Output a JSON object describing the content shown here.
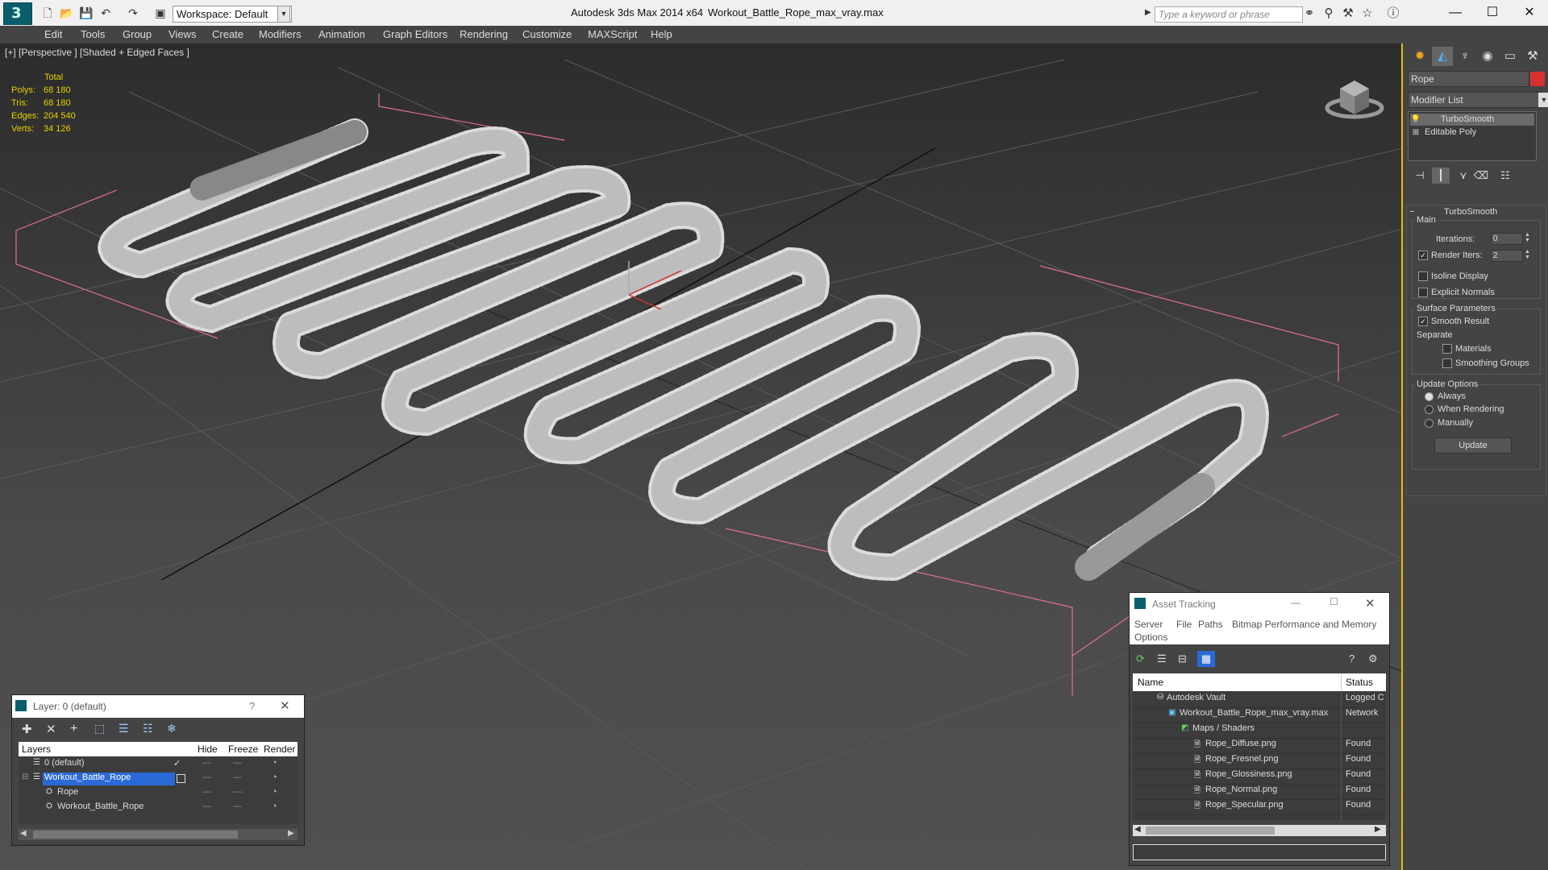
{
  "titlebar": {
    "workspace": "Workspace: Default",
    "app_title": "Autodesk 3ds Max  2014 x64",
    "file_title": "Workout_Battle_Rope_max_vray.max",
    "search_placeholder": "Type a keyword or phrase",
    "minimize": "—",
    "maximize": "☐",
    "close": "✕"
  },
  "menu": [
    "Edit",
    "Tools",
    "Group",
    "Views",
    "Create",
    "Modifiers",
    "Animation",
    "Graph Editors",
    "Rendering",
    "Customize",
    "MAXScript",
    "Help"
  ],
  "viewport": {
    "label": "[+] [Perspective ] [Shaded + Edged Faces ]",
    "stats": {
      "header": "Total",
      "rows": [
        {
          "label": "Polys:",
          "value": "68 180"
        },
        {
          "label": "Tris:",
          "value": "68 180"
        },
        {
          "label": "Edges:",
          "value": "204 540"
        },
        {
          "label": "Verts:",
          "value": "34 126"
        }
      ]
    }
  },
  "command_panel": {
    "object_name": "Rope",
    "object_color": "#d63030",
    "modifier_list": "Modifier List",
    "stack": [
      "TurboSmooth",
      "Editable Poly"
    ],
    "rollout": {
      "title": "TurboSmooth",
      "main": "Main",
      "iterations_label": "Iterations:",
      "iterations_value": "0",
      "render_iters_label": "Render Iters:",
      "render_iters_value": "2",
      "isoline": "Isoline Display",
      "explicit": "Explicit Normals",
      "surface_params": "Surface Parameters",
      "smooth_result": "Smooth Result",
      "separate": "Separate",
      "materials": "Materials",
      "smoothing_groups": "Smoothing Groups",
      "update_options": "Update Options",
      "always": "Always",
      "when_rendering": "When Rendering",
      "manually": "Manually",
      "update_btn": "Update"
    }
  },
  "layer_window": {
    "title": "Layer: 0 (default)",
    "help": "?",
    "close": "✕",
    "columns": [
      "Layers",
      "Hide",
      "Freeze",
      "Render"
    ],
    "rows": [
      {
        "name": "0 (default)",
        "indent": 0,
        "selected": false
      },
      {
        "name": "Workout_Battle_Rope",
        "indent": 0,
        "selected": true
      },
      {
        "name": "Rope",
        "indent": 1,
        "selected": false
      },
      {
        "name": "Workout_Battle_Rope",
        "indent": 1,
        "selected": false
      }
    ]
  },
  "asset_window": {
    "title": "Asset Tracking",
    "menu": [
      "Server",
      "File",
      "Paths",
      "Bitmap Performance and Memory"
    ],
    "menu2": "Options",
    "columns": [
      "Name",
      "Status"
    ],
    "rows": [
      {
        "name": "Autodesk Vault",
        "status": "Logged C",
        "indent": 1
      },
      {
        "name": "Workout_Battle_Rope_max_vray.max",
        "status": "Network",
        "indent": 2
      },
      {
        "name": "Maps / Shaders",
        "status": "",
        "indent": 3
      },
      {
        "name": "Rope_Diffuse.png",
        "status": "Found",
        "indent": 4
      },
      {
        "name": "Rope_Fresnel.png",
        "status": "Found",
        "indent": 4
      },
      {
        "name": "Rope_Glossiness.png",
        "status": "Found",
        "indent": 4
      },
      {
        "name": "Rope_Normal.png",
        "status": "Found",
        "indent": 4
      },
      {
        "name": "Rope_Specular.png",
        "status": "Found",
        "indent": 4
      }
    ]
  }
}
